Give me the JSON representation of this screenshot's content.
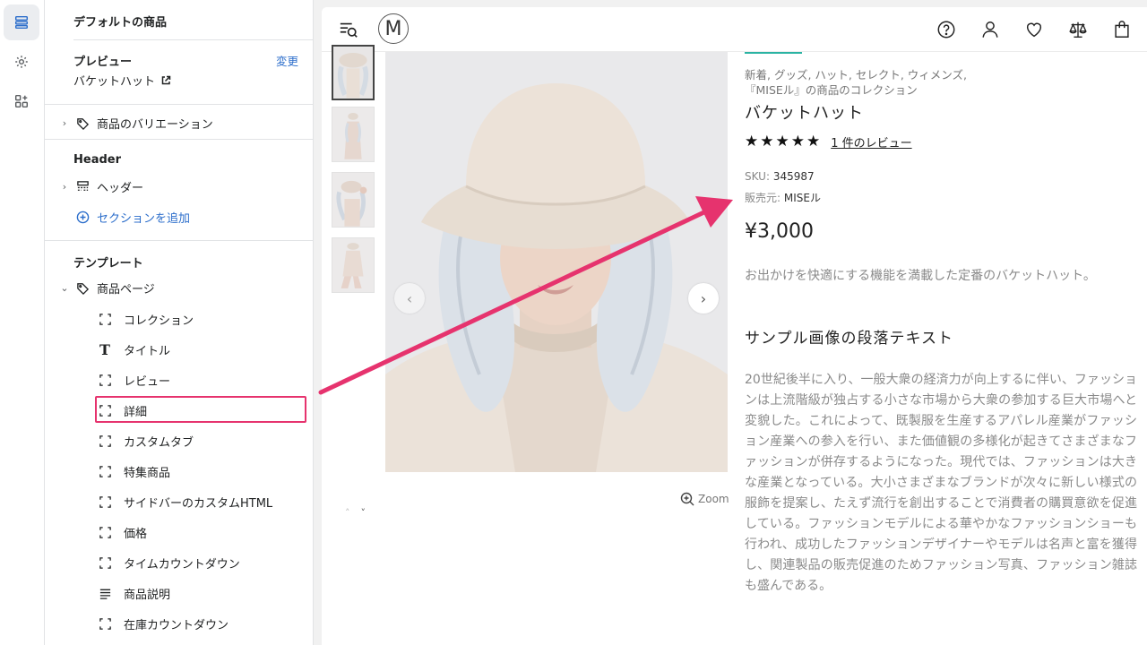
{
  "sidebar": {
    "title": "デフォルトの商品",
    "preview_label": "プレビュー",
    "change_link": "変更",
    "preview_value": "バケットハット",
    "variations_label": "商品のバリエーション",
    "header_section": "Header",
    "header_item": "ヘッダー",
    "add_section": "セクションを追加",
    "template_section": "テンプレート",
    "product_page": "商品ページ",
    "blocks": [
      "コレクション",
      "タイトル",
      "レビュー",
      "詳細",
      "カスタムタブ",
      "特集商品",
      "サイドバーのカスタムHTML",
      "価格",
      "タイムカウントダウン",
      "商品説明",
      "在庫カウントダウン"
    ],
    "highlighted_block": "詳細"
  },
  "header": {
    "logo_letter": "M"
  },
  "product": {
    "collections_line1": "新着, グッズ, ハット, セレクト, ウィメンズ,",
    "collections_line2": "『MISEル』の商品のコレクション",
    "title": "バケットハット",
    "rating": 5,
    "stars": "★★★★★",
    "review_link": "1 件のレビュー",
    "sku_label": "SKU:",
    "sku_value": "345987",
    "vendor_label": "販売元:",
    "vendor_value": "MISEル",
    "price": "¥3,000",
    "short_description": "お出かけを快適にする機能を満載した定番のバケットハット。",
    "section_heading": "サンプル画像の段落テキスト",
    "paragraph": "20世紀後半に入り、一般大衆の経済力が向上するに伴い、ファッションは上流階級が独占する小さな市場から大衆の参加する巨大市場へと変貌した。これによって、既製服を生産するアパレル産業がファッション産業への参入を行い、また価値観の多様化が起きてさまざまなファッションが併存するようになった。現代では、ファッションは大きな産業となっている。大小さまざまなブランドが次々に新しい様式の服飾を提案し、たえず流行を創出することで消費者の購買意欲を促進している。ファッションモデルによる華やかなファッションショーも行われ、成功したファッションデザイナーやモデルは名声と富を獲得し、関連製品の販売促進のためファッション写真、ファッション雑誌も盛んである。",
    "zoom_label": "Zoom"
  },
  "colors": {
    "highlight": "#e6336e",
    "link": "#2c6ecb",
    "accent": "#2bb3a3"
  }
}
